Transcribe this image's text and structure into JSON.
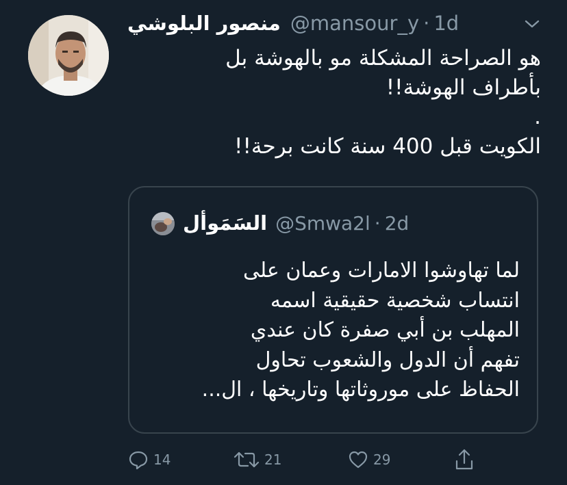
{
  "tweet": {
    "author_name": "منصور البلوشي",
    "handle": "@mansour_y",
    "separator": "·",
    "time": "1d",
    "lines": [
      "هو الصراحة المشكلة مو بالهوشة بل",
      "بأطراف الهوشة!!",
      ".",
      "الكويت قبل 400 سنة كانت برحة!!"
    ]
  },
  "quoted_tweet": {
    "author_name": "السَمَوأل",
    "handle": "@Smwa2l",
    "separator": "·",
    "time": "2d",
    "lines": [
      "لما تهاوشوا الامارات وعمان على",
      "انتساب شخصية حقيقية اسمه",
      "المهلب بن أبي صفرة كان عندي",
      "تفهم أن الدول والشعوب تحاول",
      "الحفاظ على موروثاتها وتاريخها ، ال..."
    ]
  },
  "actions": {
    "reply_count": "14",
    "retweet_count": "21",
    "like_count": "29"
  },
  "icons": {
    "menu": "chevron-down-icon",
    "reply": "reply-icon",
    "retweet": "retweet-icon",
    "like": "heart-icon",
    "share": "share-icon"
  },
  "colors": {
    "background": "#15202b",
    "text": "#ffffff",
    "secondary_text": "#8899a6",
    "border": "#38444d"
  }
}
